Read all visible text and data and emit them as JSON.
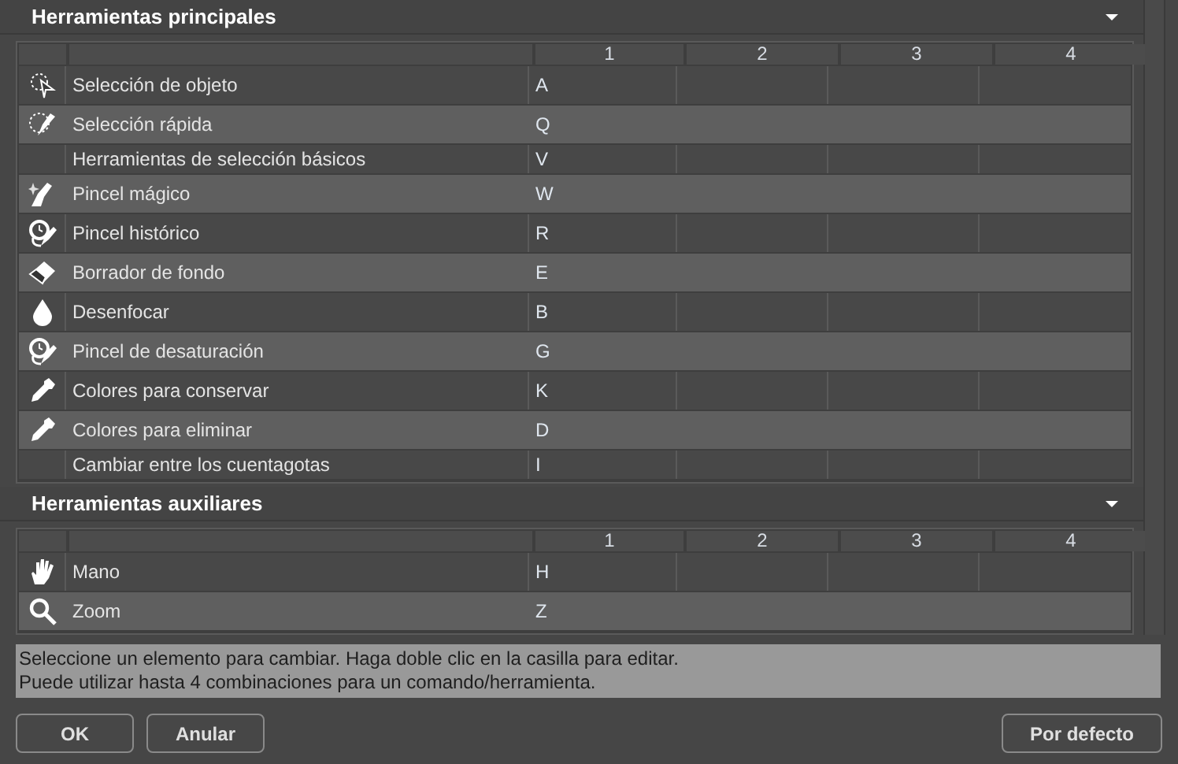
{
  "sections": [
    {
      "title": "Herramientas principales",
      "expanded": true,
      "columns": [
        "1",
        "2",
        "3",
        "4"
      ],
      "rows": [
        {
          "kind": "lasso",
          "name": "Selección de objeto",
          "keys": [
            "A"
          ]
        },
        {
          "kind": "brush",
          "name": "Selección rápida",
          "keys": [
            "Q"
          ]
        },
        {
          "kind": "plain",
          "name": "Herramientas de selección básicos",
          "keys": [
            "V"
          ]
        },
        {
          "kind": "magic",
          "name": "Pincel mágico",
          "keys": [
            "W"
          ]
        },
        {
          "kind": "history",
          "name": "Pincel histórico",
          "keys": [
            "R"
          ]
        },
        {
          "kind": "eraser",
          "name": "Borrador de fondo",
          "keys": [
            "E"
          ]
        },
        {
          "kind": "drop",
          "name": "Desenfocar",
          "keys": [
            "B"
          ]
        },
        {
          "kind": "history",
          "name": "Pincel de desaturación",
          "keys": [
            "G"
          ]
        },
        {
          "kind": "dropper",
          "name": "Colores para conservar",
          "keys": [
            "K"
          ]
        },
        {
          "kind": "dropper",
          "name": "Colores para eliminar",
          "keys": [
            "D"
          ]
        },
        {
          "kind": "plain",
          "name": "Cambiar entre los cuentagotas",
          "keys": [
            "I"
          ]
        }
      ]
    },
    {
      "title": "Herramientas auxiliares",
      "expanded": true,
      "columns": [
        "1",
        "2",
        "3",
        "4"
      ],
      "rows": [
        {
          "kind": "hand",
          "name": "Mano",
          "keys": [
            "H"
          ]
        },
        {
          "kind": "zoom",
          "name": "Zoom",
          "keys": [
            "Z"
          ]
        }
      ]
    }
  ],
  "info": [
    "Seleccione un elemento para cambiar. Haga doble clic en la casilla para editar.",
    "Puede utilizar hasta 4 combinaciones para un comando/herramienta."
  ],
  "buttons": [
    {
      "label": "OK"
    },
    {
      "label": "Anular"
    }
  ],
  "default_button": {
    "label": "Por defecto"
  }
}
